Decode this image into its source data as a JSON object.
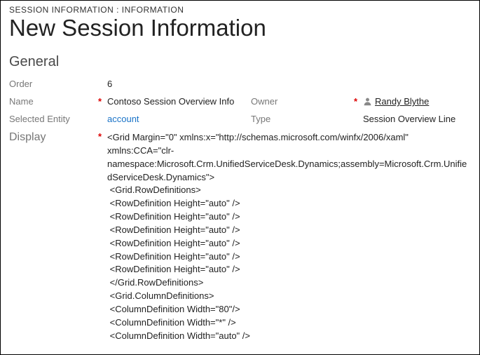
{
  "breadcrumb": "SESSION INFORMATION : INFORMATION",
  "title": "New Session Information",
  "section": "General",
  "fields": {
    "order_label": "Order",
    "order_value": "6",
    "name_label": "Name",
    "name_value": "Contoso Session Overview Info",
    "owner_label": "Owner",
    "owner_value": "Randy Blythe",
    "selected_entity_label": "Selected Entity",
    "selected_entity_value": "account",
    "type_label": "Type",
    "type_value": "Session Overview Line",
    "display_label": "Display",
    "display_value": "<Grid Margin=\"0\" xmlns:x=\"http://schemas.microsoft.com/winfx/2006/xaml\" xmlns:CCA=\"clr-namespace:Microsoft.Crm.UnifiedServiceDesk.Dynamics;assembly=Microsoft.Crm.UnifiedServiceDesk.Dynamics\">\n <Grid.RowDefinitions>\n <RowDefinition Height=\"auto\" />\n <RowDefinition Height=\"auto\" />\n <RowDefinition Height=\"auto\" />\n <RowDefinition Height=\"auto\" />\n <RowDefinition Height=\"auto\" />\n <RowDefinition Height=\"auto\" />\n </Grid.RowDefinitions>\n <Grid.ColumnDefinitions>\n <ColumnDefinition Width=\"80\"/>\n <ColumnDefinition Width=\"*\" />\n <ColumnDefinition Width=\"auto\" />"
  },
  "required_marker": "*"
}
